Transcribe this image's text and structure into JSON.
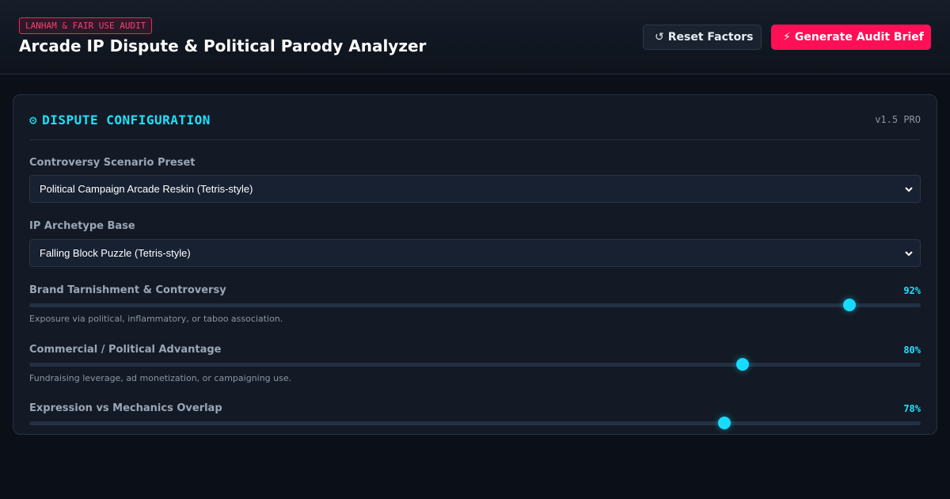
{
  "header": {
    "badge": "LANHAM & FAIR USE AUDIT",
    "title": "Arcade IP Dispute & Political Parody Analyzer",
    "reset_label": "Reset Factors",
    "reset_icon": "↺",
    "generate_label": "Generate Audit Brief",
    "generate_icon": "⚡"
  },
  "panel": {
    "icon": "⚙",
    "title": "DISPUTE CONFIGURATION",
    "version": "v1.5 PRO",
    "scenario": {
      "label": "Controversy Scenario Preset",
      "value": "Political Campaign Arcade Reskin (Tetris-style)"
    },
    "archetype": {
      "label": "IP Archetype Base",
      "value": "Falling Block Puzzle (Tetris-style)"
    },
    "sliders": [
      {
        "label": "Brand Tarnishment & Controversy",
        "value": 92,
        "display": "92%",
        "help": "Exposure via political, inflammatory, or taboo association."
      },
      {
        "label": "Commercial / Political Advantage",
        "value": 80,
        "display": "80%",
        "help": "Fundraising leverage, ad monetization, or campaigning use."
      },
      {
        "label": "Expression vs Mechanics Overlap",
        "value": 78,
        "display": "78%",
        "help": ""
      }
    ]
  },
  "colors": {
    "accent": "#1ee0ff",
    "brand": "#ff0f55",
    "background": "#0b0f17"
  }
}
